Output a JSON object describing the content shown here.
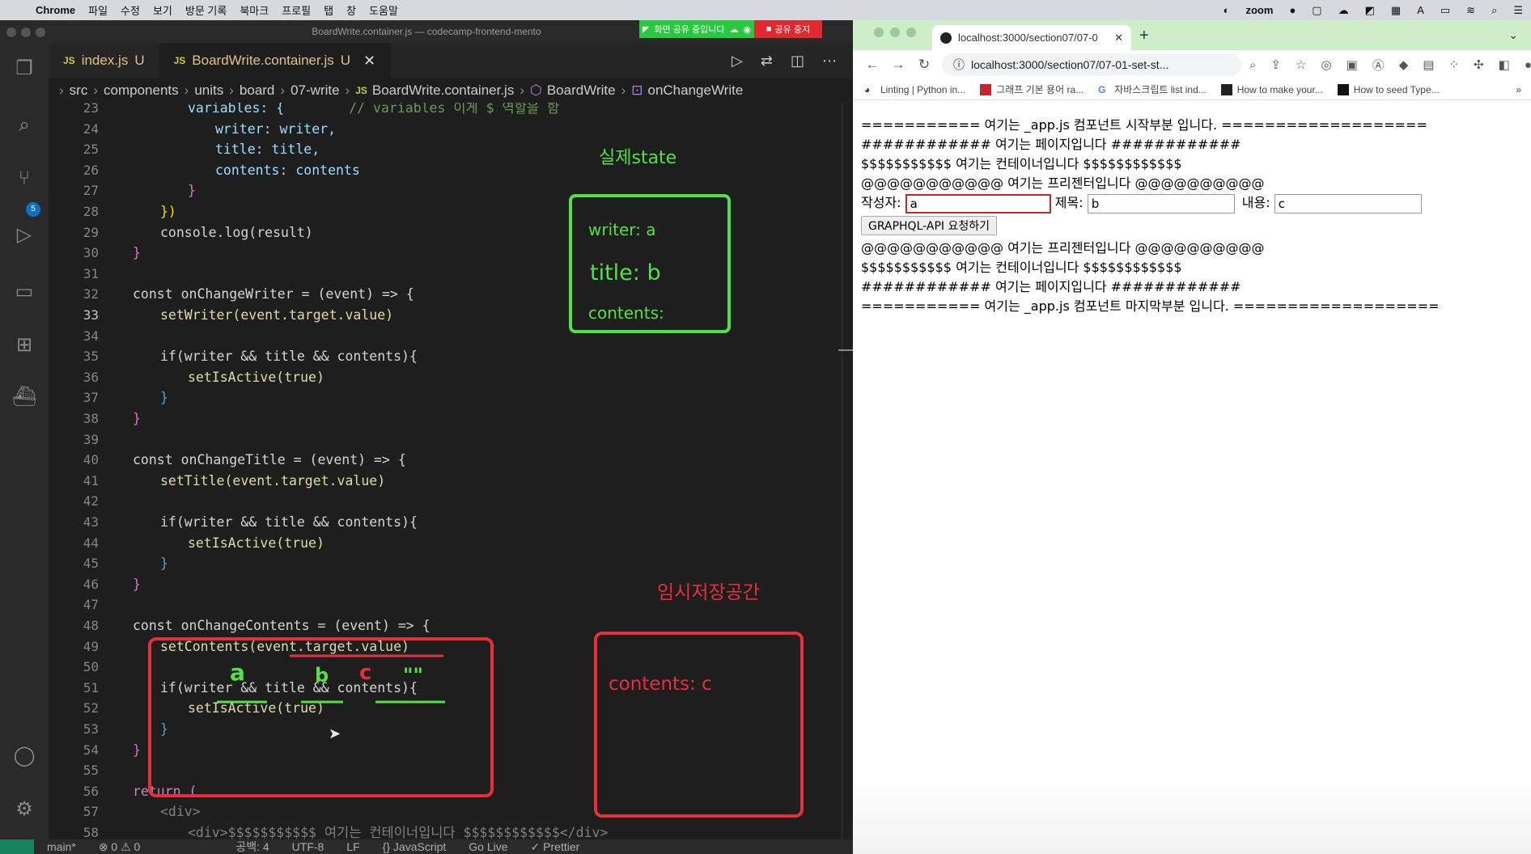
{
  "menubar": {
    "app": "Chrome",
    "items": [
      "파일",
      "수정",
      "보기",
      "방문 기록",
      "북마크",
      "프로필",
      "탭",
      "창",
      "도움말"
    ],
    "zoom": "zoom"
  },
  "vscode": {
    "window_title": "BoardWrite.container.js — codecamp-frontend-mento",
    "share_banner": {
      "sharing": "화면 공유 중입니다",
      "stop": "공유 중지"
    },
    "scm_badge": "5",
    "tabs": [
      {
        "name": "index.js",
        "status": "U"
      },
      {
        "name": "BoardWrite.container.js",
        "status": "U"
      }
    ],
    "breadcrumb": [
      "src",
      "components",
      "units",
      "board",
      "07-write",
      "BoardWrite.container.js",
      "BoardWrite",
      "onChangeWrite"
    ],
    "lines": [
      {
        "n": "23",
        "cur": false
      },
      {
        "n": "24",
        "cur": false
      },
      {
        "n": "25",
        "cur": false
      },
      {
        "n": "26",
        "cur": false
      },
      {
        "n": "27",
        "cur": false
      },
      {
        "n": "28",
        "cur": false
      },
      {
        "n": "29",
        "cur": false
      },
      {
        "n": "30",
        "cur": false
      },
      {
        "n": "31",
        "cur": false
      },
      {
        "n": "32",
        "cur": false
      },
      {
        "n": "33",
        "cur": true
      },
      {
        "n": "34",
        "cur": false
      },
      {
        "n": "35",
        "cur": false
      },
      {
        "n": "36",
        "cur": false
      },
      {
        "n": "37",
        "cur": false
      },
      {
        "n": "38",
        "cur": false
      },
      {
        "n": "39",
        "cur": false
      },
      {
        "n": "40",
        "cur": false
      },
      {
        "n": "41",
        "cur": false
      },
      {
        "n": "42",
        "cur": false
      },
      {
        "n": "43",
        "cur": false
      },
      {
        "n": "44",
        "cur": false
      },
      {
        "n": "45",
        "cur": false
      },
      {
        "n": "46",
        "cur": false
      },
      {
        "n": "47",
        "cur": false
      },
      {
        "n": "48",
        "cur": false
      },
      {
        "n": "49",
        "cur": false
      },
      {
        "n": "50",
        "cur": false
      },
      {
        "n": "51",
        "cur": false
      },
      {
        "n": "52",
        "cur": false
      },
      {
        "n": "53",
        "cur": false
      },
      {
        "n": "54",
        "cur": false
      },
      {
        "n": "55",
        "cur": false
      },
      {
        "n": "56",
        "cur": false
      },
      {
        "n": "57",
        "cur": false
      },
      {
        "n": "58",
        "cur": false
      }
    ],
    "code": {
      "l23_a": "variables: {",
      "l23_b": "// variables 이게 $ 역할을 함",
      "l24": "writer: writer,",
      "l25": "title: title,",
      "l26": "contents: contents",
      "l27": "}",
      "l28": "})",
      "l29": "console.log(result)",
      "l30": "}",
      "l32": "const onChangeWriter = (event) => {",
      "l33": "setWriter(event.target.value)",
      "l35": "if(writer && title && contents){",
      "l36": "setIsActive(true)",
      "l37": "}",
      "l38": "}",
      "l40": "const onChangeTitle = (event) => {",
      "l41": "setTitle(event.target.value)",
      "l43": "if(writer && title && contents){",
      "l44": "setIsActive(true)",
      "l45": "}",
      "l46": "}",
      "l48": "const onChangeContents = (event) => {",
      "l49": "setContents(event.target.value)",
      "l51": "if(writer && title && contents){",
      "l52": "setIsActive(true)",
      "l53": "}",
      "l54": "}",
      "l56": "return (",
      "l57": "<div>",
      "l58": "<div>$$$$$$$$$$$ 여기는 컨테이너입니다 $$$$$$$$$$$$</div>"
    },
    "annotations": {
      "green_title": "실제state",
      "green_writer": "writer: a",
      "green_title_val": "title: b",
      "green_contents": "contents:",
      "red_title": "임시저장공간",
      "red_contents": "contents: c",
      "scribble_a": "a",
      "scribble_b": "b",
      "scribble_c": "c",
      "scribble_empty": "\"\""
    },
    "status": {
      "branch": "main*",
      "problems": "⊗ 0 ⚠ 0",
      "spaces": "공백: 4",
      "encoding": "UTF-8",
      "eol": "LF",
      "language": "{} JavaScript",
      "golive": "Go Live",
      "prettier": "✓ Prettier"
    }
  },
  "browser": {
    "tab_title": "localhost:3000/section07/07-0",
    "url": "localhost:3000/section07/07-01-set-st...",
    "bookmarks": [
      "Linting | Python in...",
      "그래프 기본 용어 ra...",
      "자바스크립트 list ind...",
      "How to make your...",
      "How to seed Type..."
    ],
    "page": {
      "lines_top": [
        "=========== 여기는 _app.js 컴포넌트 시작부분 입니다. ===================",
        "############ 여기는 페이지입니다 ############",
        "$$$$$$$$$$$ 여기는 컨테이너입니다 $$$$$$$$$$$$",
        "@@@@@@@@@@@ 여기는 프리젠터입니다 @@@@@@@@@@"
      ],
      "writer_label": "작성자:",
      "writer_value": "a",
      "title_label": "제목:",
      "title_value": "b",
      "contents_label": "내용:",
      "contents_value": "c",
      "submit_button": "GRAPHQL-API 요청하기",
      "lines_bottom": [
        "@@@@@@@@@@@ 여기는 프리젠터입니다 @@@@@@@@@@",
        "$$$$$$$$$$$ 여기는 컨테이너입니다 $$$$$$$$$$$$",
        "############ 여기는 페이지입니다 ############",
        "=========== 여기는 _app.js 컴포넌트 마지막부분 입니다. ==================="
      ]
    }
  },
  "colors": {
    "green": "#55e045",
    "red": "#e62e3c",
    "red_text": "#e62e3c",
    "vscode_bg": "#1e1e1e"
  }
}
